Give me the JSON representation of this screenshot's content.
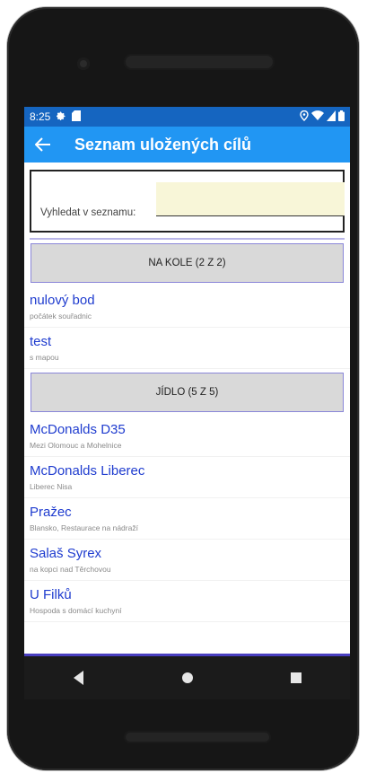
{
  "status_bar": {
    "time": "8:25",
    "left_icons": [
      "gear-icon",
      "sd-card-icon"
    ],
    "right_icons": [
      "location-icon",
      "wifi-icon",
      "signal-icon",
      "battery-icon"
    ]
  },
  "app_bar": {
    "title": "Seznam uložených cílů",
    "back_icon": "arrow-left-icon"
  },
  "search": {
    "label": "Vyhledat v seznamu:",
    "value": ""
  },
  "groups": [
    {
      "header": "NA KOLE (2 Z 2)",
      "items": [
        {
          "name": "nulový bod",
          "desc": "počátek souřadnic"
        },
        {
          "name": "test",
          "desc": "s mapou"
        }
      ]
    },
    {
      "header": "JÍDLO (5 Z 5)",
      "items": [
        {
          "name": "McDonalds D35",
          "desc": "Mezi Olomouc a Mohelnice"
        },
        {
          "name": "McDonalds Liberec",
          "desc": "Liberec Nisa"
        },
        {
          "name": "Pražec",
          "desc": "Blansko, Restaurace na nádraží"
        },
        {
          "name": "Salaš Syrex",
          "desc": "na kopci nad Těrchovou"
        },
        {
          "name": "U Filků",
          "desc": "Hospoda s domácí kuchyní"
        }
      ]
    }
  ],
  "nav_bar": {
    "icons": [
      "back-triangle-icon",
      "home-circle-icon",
      "recents-square-icon"
    ]
  }
}
